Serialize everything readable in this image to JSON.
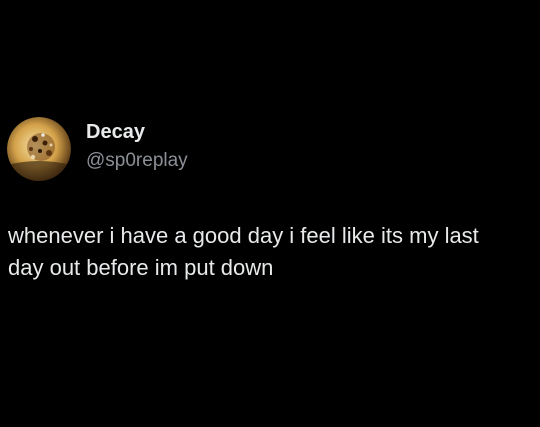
{
  "tweet": {
    "display_name": "Decay",
    "handle": "@sp0replay",
    "text": "whenever i have a good day i feel like its my last\nday out before im put down"
  },
  "icons": {
    "avatar": "profile-avatar-image"
  },
  "colors": {
    "background": "#000000",
    "primary_text": "#e7e9ea",
    "secondary_text": "#8b9096"
  }
}
